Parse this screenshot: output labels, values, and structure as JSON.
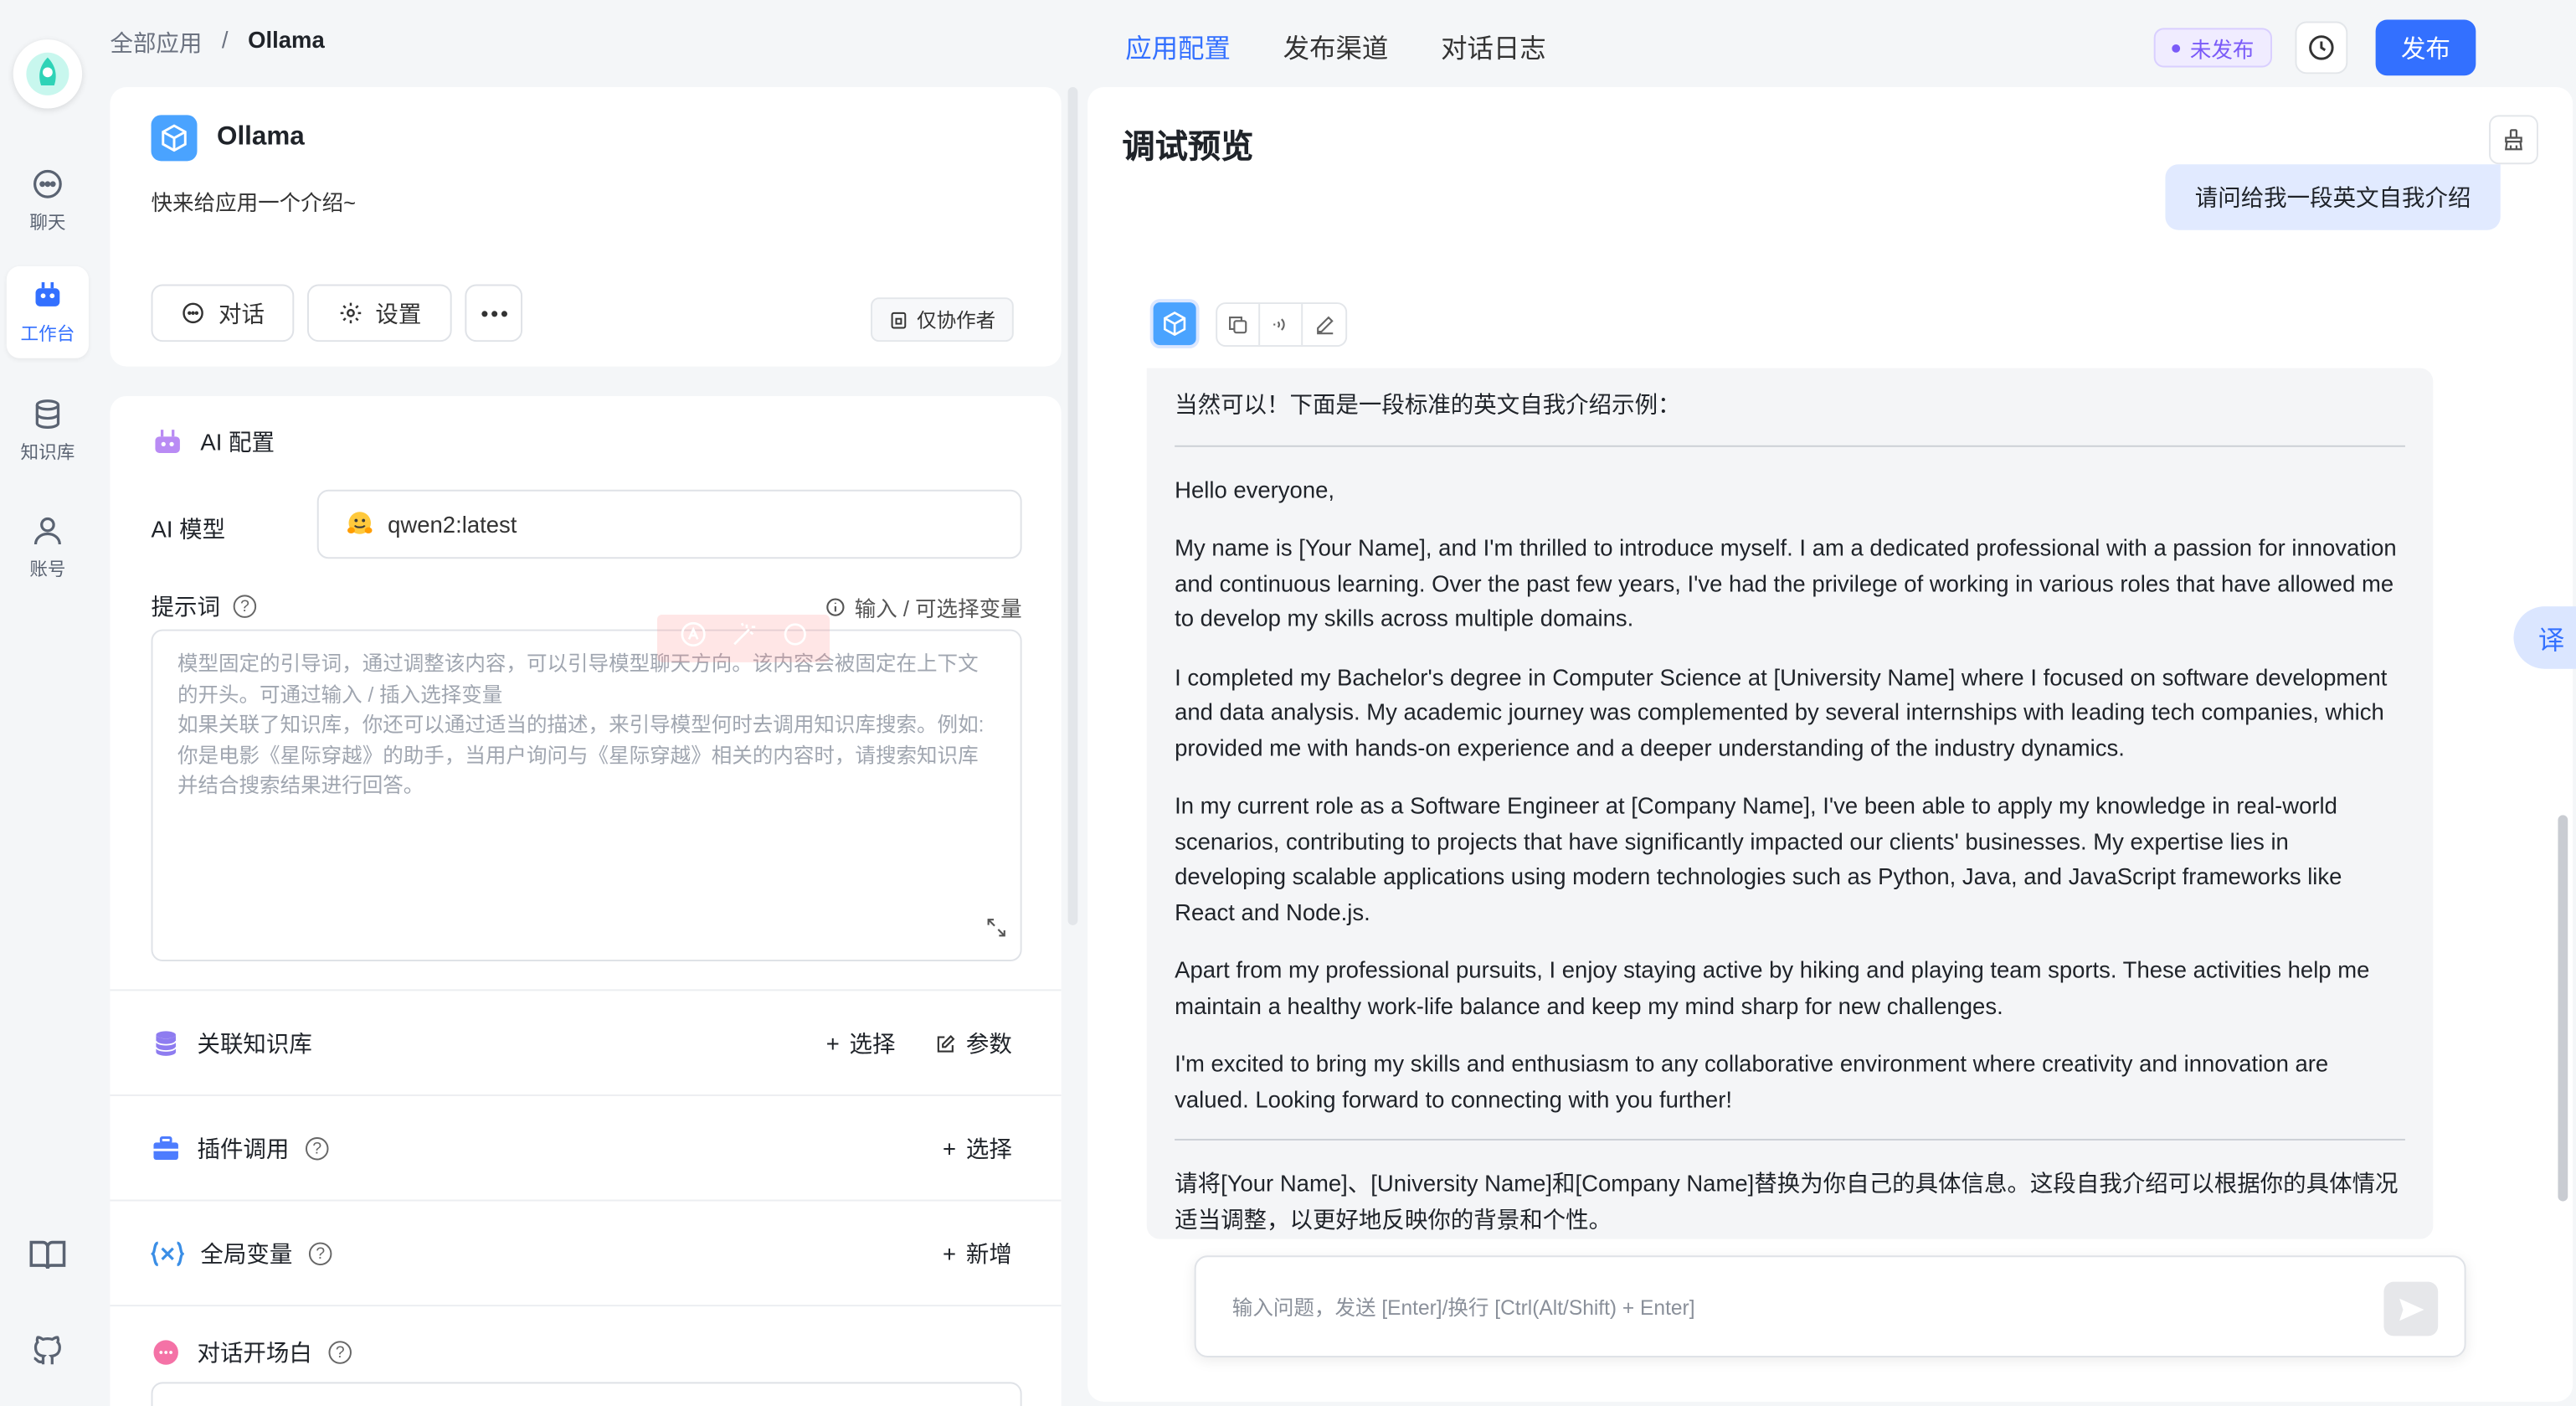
{
  "rail": {
    "items": [
      {
        "label": "聊天",
        "icon": "chat-icon"
      },
      {
        "label": "工作台",
        "icon": "robot-icon",
        "active": true
      },
      {
        "label": "知识库",
        "icon": "database-icon"
      },
      {
        "label": "账号",
        "icon": "user-icon"
      }
    ],
    "bottom_icons": [
      "book-icon",
      "github-icon"
    ]
  },
  "breadcrumb": {
    "root": "全部应用",
    "sep": "/",
    "current": "Ollama"
  },
  "tabs": [
    "应用配置",
    "发布渠道",
    "对话日志"
  ],
  "status_badge": "未发布",
  "publish_label": "发布",
  "app": {
    "name": "Ollama",
    "desc": "快来给应用一个介绍~",
    "chat_btn": "对话",
    "settings_btn": "设置",
    "collab": "仅协作者"
  },
  "config": {
    "title": "AI 配置",
    "model_label": "AI 模型",
    "model_value": "qwen2:latest",
    "prompt_label": "提示词",
    "prompt_var_hint": "输入 / 可选择变量",
    "prompt_placeholder": "模型固定的引导词，通过调整该内容，可以引导模型聊天方向。该内容会被固定在上下文的开头。可通过输入 / 插入选择变量\n如果关联了知识库，你还可以通过适当的描述，来引导模型何时去调用知识库搜索。例如:\n你是电影《星际穿越》的助手，当用户询问与《星际穿越》相关的内容时，请搜索知识库并结合搜索结果进行回答。",
    "kb_label": "关联知识库",
    "kb_select": "选择",
    "kb_params": "参数",
    "plugin_label": "插件调用",
    "plugin_select": "选择",
    "vars_label": "全局变量",
    "vars_add": "新增",
    "opener_label": "对话开场白"
  },
  "preview": {
    "title": "调试预览",
    "user_msg": "请问给我一段英文自我介绍",
    "bot_intro": "当然可以！下面是一段标准的英文自我介绍示例：",
    "bot_paragraphs": [
      "Hello everyone,",
      "My name is [Your Name], and I'm thrilled to introduce myself. I am a dedicated professional with a passion for innovation and continuous learning. Over the past few years, I've had the privilege of working in various roles that have allowed me to develop my skills across multiple domains.",
      "I completed my Bachelor's degree in Computer Science at [University Name] where I focused on software development and data analysis. My academic journey was complemented by several internships with leading tech companies, which provided me with hands-on experience and a deeper understanding of the industry dynamics.",
      "In my current role as a Software Engineer at [Company Name], I've been able to apply my knowledge in real-world scenarios, contributing to projects that have significantly impacted our clients' businesses. My expertise lies in developing scalable applications using modern technologies such as Python, Java, and JavaScript frameworks like React and Node.js.",
      "Apart from my professional pursuits, I enjoy staying active by hiking and playing team sports. These activities help me maintain a healthy work-life balance and keep my mind sharp for new challenges.",
      "I'm excited to bring my skills and enthusiasm to any collaborative environment where creativity and innovation are valued. Looking forward to connecting with you further!"
    ],
    "bot_outro": "请将[Your Name]、[University Name]和[Company Name]替换为你自己的具体信息。这段自我介绍可以根据你的具体情况适当调整，以更好地反映你的背景和个性。",
    "input_placeholder": "输入问题，发送 [Enter]/换行 [Ctrl(Alt/Shift) + Enter]"
  },
  "translate_fab": "译",
  "colors": {
    "accent": "#3370ff",
    "badge": "#7a5af8",
    "user_bubble": "#e1eaff"
  }
}
